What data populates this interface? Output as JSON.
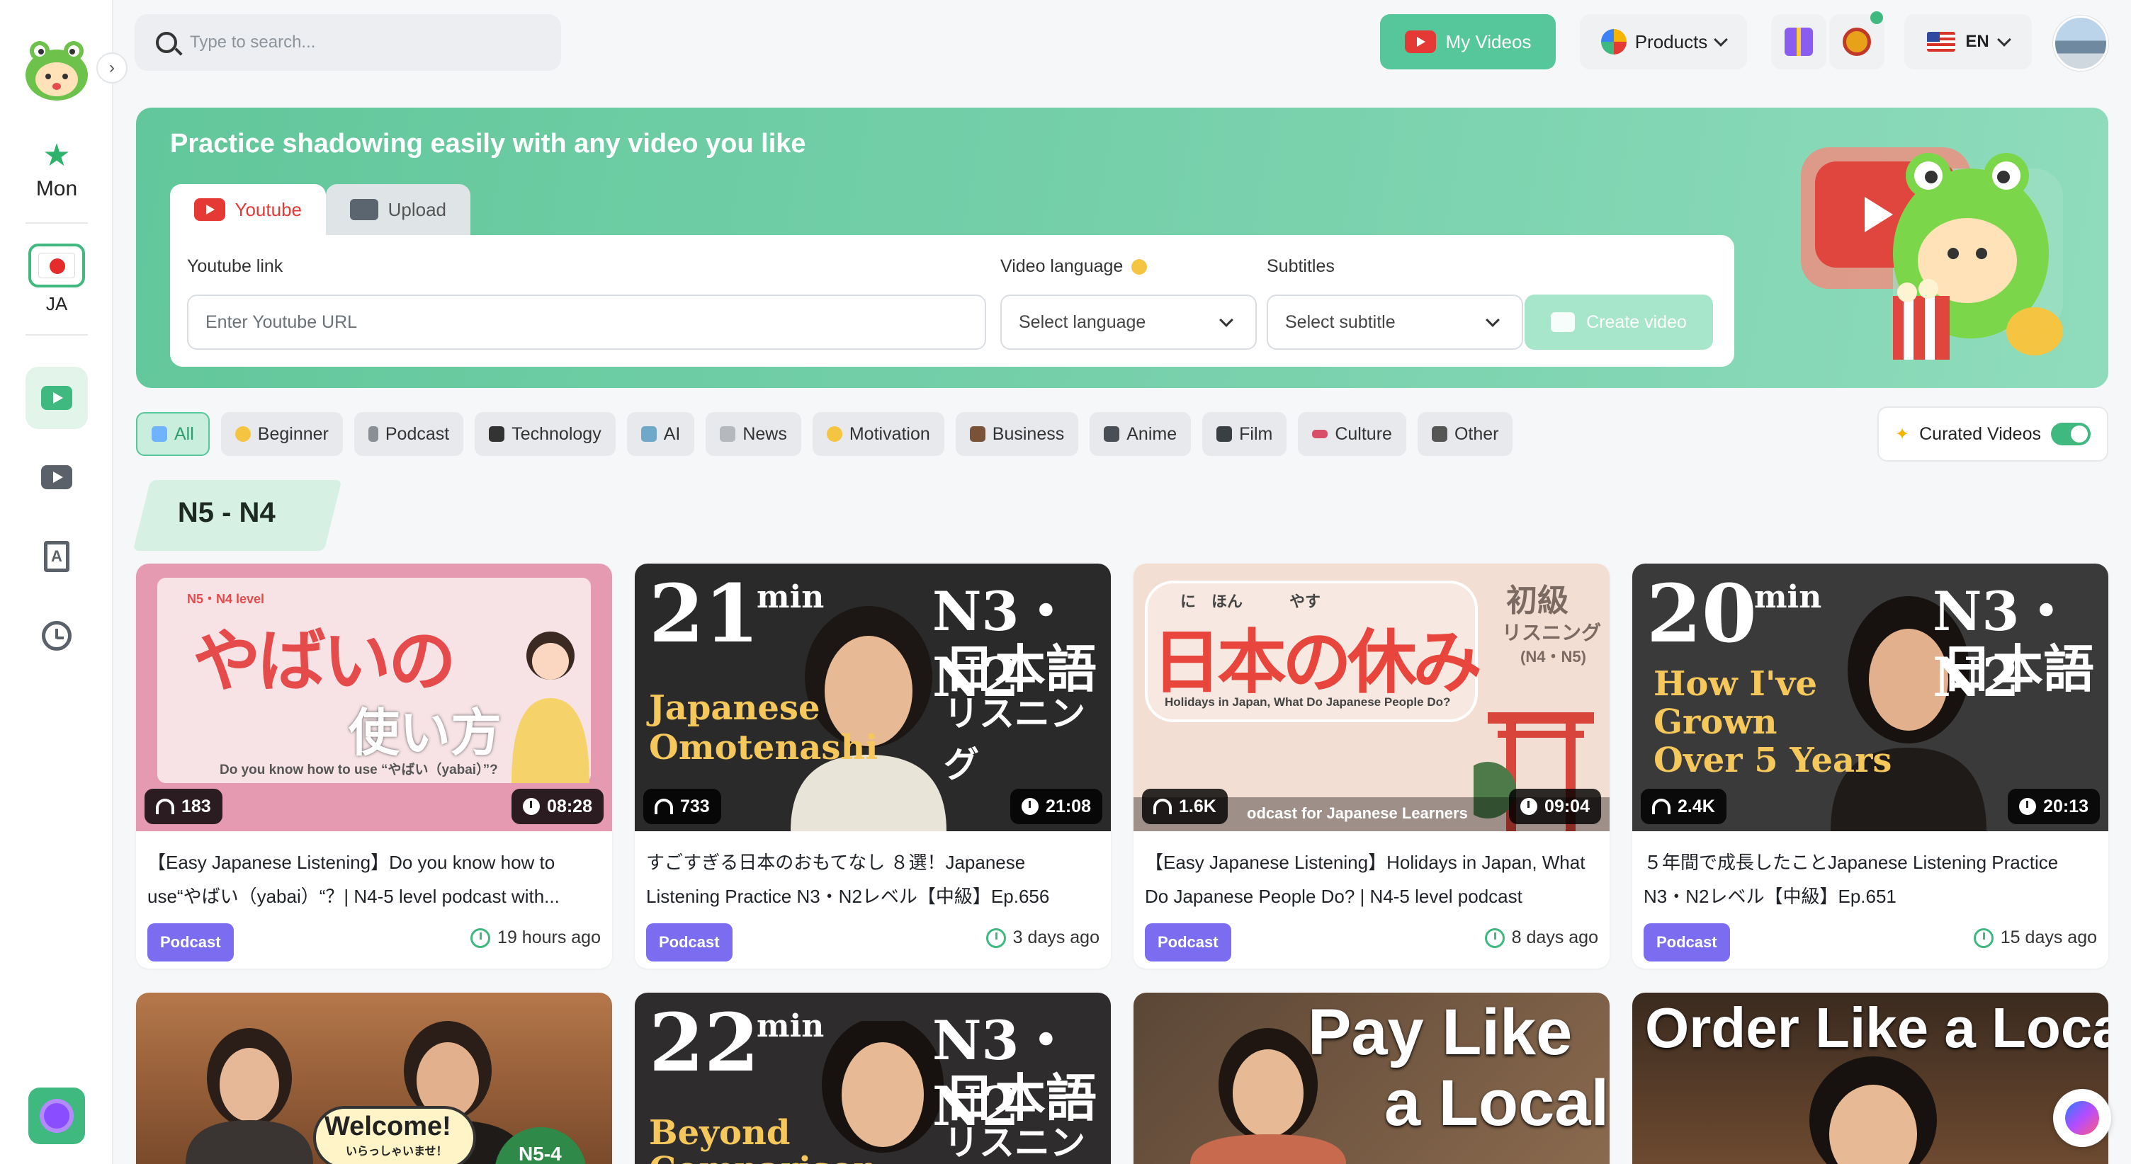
{
  "sidebar": {
    "streak_day": "Mon",
    "language_code": "JA"
  },
  "header": {
    "search_placeholder": "Type to search...",
    "my_videos_label": "My Videos",
    "products_label": "Products",
    "ui_language": "EN"
  },
  "hero": {
    "title": "Practice shadowing easily with any video you like",
    "tabs": [
      {
        "label": "Youtube"
      },
      {
        "label": "Upload"
      }
    ],
    "youtube_link_label": "Youtube link",
    "youtube_placeholder": "Enter Youtube URL",
    "video_language_label": "Video language",
    "video_language_value": "Select language",
    "subtitles_label": "Subtitles",
    "subtitles_value": "Select subtitle",
    "create_label": "Create video"
  },
  "filters": [
    {
      "label": "All",
      "active": true
    },
    {
      "label": "Beginner"
    },
    {
      "label": "Podcast"
    },
    {
      "label": "Technology"
    },
    {
      "label": "AI"
    },
    {
      "label": "News"
    },
    {
      "label": "Motivation"
    },
    {
      "label": "Business"
    },
    {
      "label": "Anime"
    },
    {
      "label": "Film"
    },
    {
      "label": "Culture"
    },
    {
      "label": "Other"
    }
  ],
  "curated": {
    "label": "Curated Videos",
    "enabled": true
  },
  "section": {
    "title": "N5 - N4"
  },
  "cards": [
    {
      "title": "【Easy Japanese Listening】Do you know how to use“やばい（yabai）“？| N4-5 level podcast with...",
      "listens": "183",
      "duration": "08:28",
      "tag": "Podcast",
      "ago": "19 hours ago",
      "thumb": {
        "main": "やばいの",
        "sub": "使い方",
        "small": "N5・N4 level",
        "caption": "Do you know how to use “やばい（yabai）”?"
      }
    },
    {
      "title": "すごすぎる日本のおもてなし ８選！Japanese Listening Practice N3・N2レベル【中級】Ep.656",
      "listens": "733",
      "duration": "21:08",
      "tag": "Podcast",
      "ago": "3 days ago",
      "thumb": {
        "num": "21",
        "unit": "min",
        "level": "N3・N2",
        "jp1": "日本語",
        "jp2": "リスニング",
        "en1": "Japanese",
        "en2": "Omotenashi"
      }
    },
    {
      "title": "【Easy Japanese Listening】Holidays in Japan, What Do Japanese People Do? | N4-5 level podcast",
      "listens": "1.6K",
      "duration": "09:04",
      "tag": "Podcast",
      "ago": "8 days ago",
      "thumb": {
        "main": "日本の休み",
        "ruby": "に　ほん　　　やす",
        "side1": "初級",
        "side2": "リスニング",
        "side3": "(N4・N5)",
        "caption": "Holidays in Japan, What Do Japanese People Do?",
        "footer": "odcast for Japanese Learners"
      }
    },
    {
      "title": "５年間で成長したことJapanese Listening Practice N3・N2レベル【中級】Ep.651",
      "listens": "2.4K",
      "duration": "20:13",
      "tag": "Podcast",
      "ago": "15 days ago",
      "thumb": {
        "num": "20",
        "unit": "min",
        "level": "N3・N2",
        "jp1": "日本語",
        "en1": "How I've",
        "en2": "Grown",
        "en3": "Over 5 Years"
      }
    },
    {
      "thumb": {
        "welcome": "Welcome!",
        "welcome_jp": "いらっしゃいませ！",
        "level": "N5-4"
      }
    },
    {
      "thumb": {
        "num": "22",
        "unit": "min",
        "level": "N3・N2",
        "jp1": "日本語",
        "jp2": "リスニング",
        "en1": "Beyond",
        "en2": "Comparison"
      }
    },
    {
      "thumb": {
        "line1": "Pay Like",
        "line2": "a Local"
      }
    },
    {
      "thumb": {
        "line1": "Order Like a Local"
      }
    }
  ]
}
